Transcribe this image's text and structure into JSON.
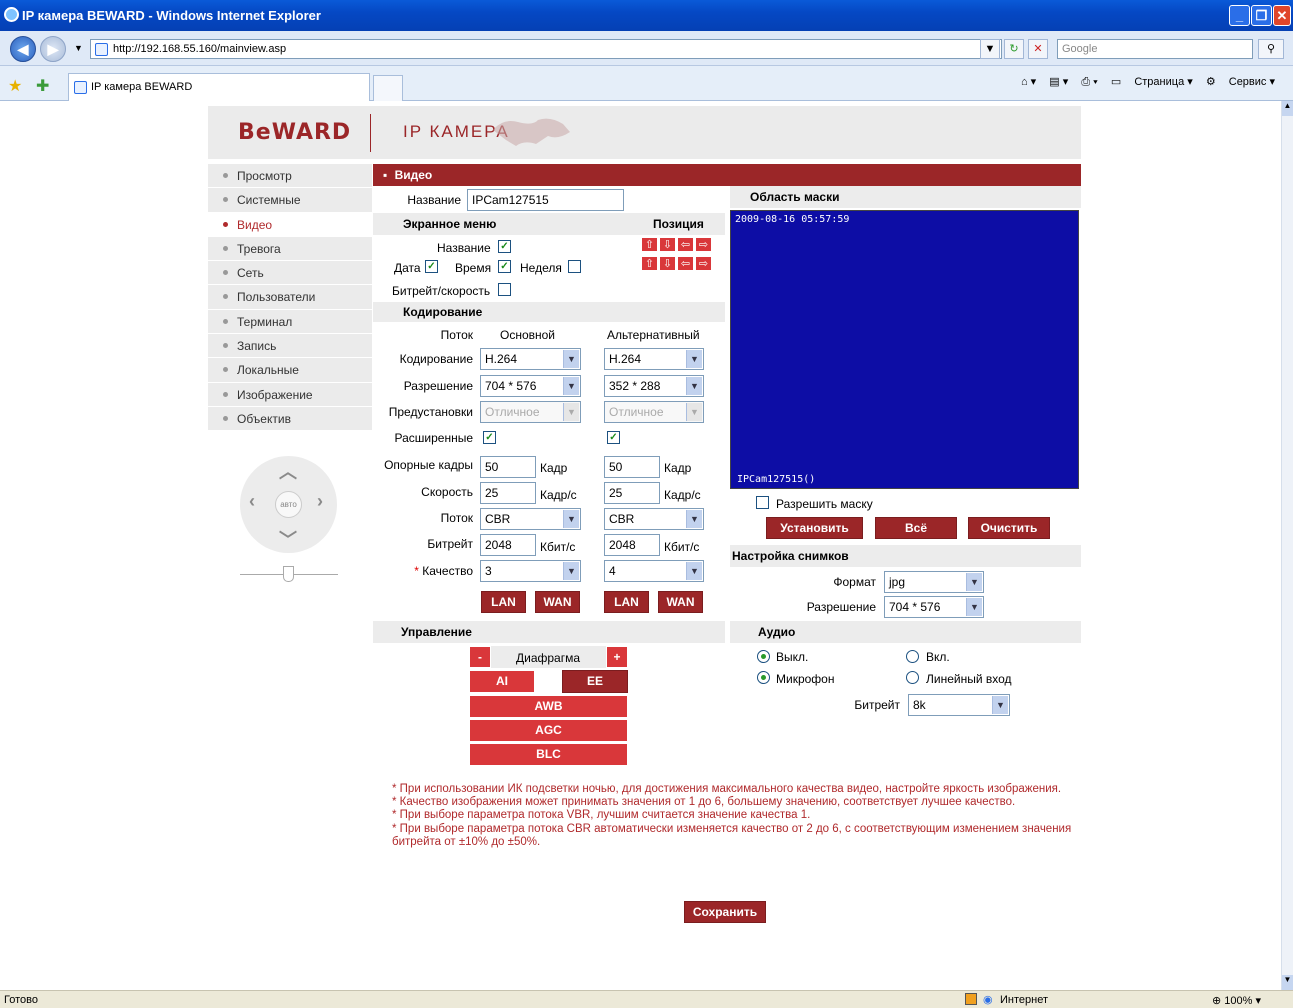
{
  "browser": {
    "title": "IP камера BEWARD - Windows Internet Explorer",
    "url": "http://192.168.55.160/mainview.asp",
    "search_placeholder": "Google",
    "tab_label": "IP камера BEWARD",
    "tools": {
      "page": "Страница",
      "service": "Сервис"
    },
    "status_left": "Готово",
    "status_zone": "Интернет",
    "zoom": "100%"
  },
  "header": {
    "logo": "BeWARD",
    "subtitle": "IP КАМЕРА"
  },
  "menu": [
    "Просмотр",
    "Системные",
    "Видео",
    "Тревога",
    "Сеть",
    "Пользователи",
    "Терминал",
    "Запись",
    "Локальные",
    "Изображение",
    "Объектив"
  ],
  "menu_active": "Видео",
  "ptz": {
    "auto_label": "авто"
  },
  "video": {
    "section_title": "Видео",
    "name_label": "Название",
    "name_value": "IPCam127515",
    "osd": {
      "title": "Экранное меню",
      "position_title": "Позиция",
      "name_label": "Название",
      "date_label": "Дата",
      "time_label": "Время",
      "week_label": "Неделя",
      "bitrate_label": "Битрейт/скорость"
    },
    "encoding": {
      "title": "Кодирование",
      "stream_label": "Поток",
      "main_label": "Основной",
      "alt_label": "Альтернативный",
      "rows": {
        "codec": "Кодирование",
        "resolution": "Разрешение",
        "preset": "Предустановки",
        "advanced": "Расширенные",
        "keyframes": "Опорные кадры",
        "speed": "Скорость",
        "stream": "Поток",
        "bitrate": "Битрейт",
        "quality": "Качество"
      },
      "main": {
        "codec": "H.264",
        "resolution": "704 * 576",
        "preset": "Отличное",
        "keyframes": "50",
        "speed": "25",
        "stream": "CBR",
        "bitrate": "2048",
        "quality": "3"
      },
      "alt": {
        "codec": "H.264",
        "resolution": "352 * 288",
        "preset": "Отличное",
        "keyframes": "50",
        "speed": "25",
        "stream": "CBR",
        "bitrate": "2048",
        "quality": "4"
      },
      "units": {
        "frame": "Кадр",
        "fps": "Кадр/с",
        "kbps": "Кбит/с"
      },
      "lan": "LAN",
      "wan": "WAN"
    },
    "control": {
      "title": "Управление",
      "iris": "Диафрагма",
      "minus": "-",
      "plus": "+",
      "ai": "AI",
      "ee": "EE",
      "awb": "AWB",
      "agc": "AGC",
      "blc": "BLC"
    }
  },
  "mask": {
    "title": "Область маски",
    "osd_datetime": "2009-08-16 05:57:59",
    "osd_name": "IPCam127515()",
    "enable_label": "Разрешить маску",
    "set_button": "Установить",
    "all_button": "Всё",
    "clear_button": "Очистить"
  },
  "snapshot": {
    "title": "Настройка снимков",
    "format_label": "Формат",
    "format_value": "jpg",
    "resolution_label": "Разрешение",
    "resolution_value": "704 * 576"
  },
  "audio": {
    "title": "Аудио",
    "off": "Выкл.",
    "on": "Вкл.",
    "mic": "Микрофон",
    "line_in": "Линейный вход",
    "bitrate_label": "Битрейт",
    "bitrate_value": "8k"
  },
  "notes": [
    "* При использовании ИК подсветки ночью, для достижения максимального качества видео, настройте яркость изображения.",
    "* Качество изображения может принимать значения от 1 до 6, большему значению, соответствует лучшее качество.",
    "* При выборе параметра потока VBR, лучшим считается значение качества 1.",
    "* При выборе параметра потока CBR автоматически изменяется качество от 2 до 6, с соответствующим изменением значения битрейта от ±10% до ±50%."
  ],
  "save_button": "Сохранить",
  "colors": {
    "brand": "#9b2628",
    "button_red": "#d9373a",
    "preview_bg": "#0d0da5"
  }
}
